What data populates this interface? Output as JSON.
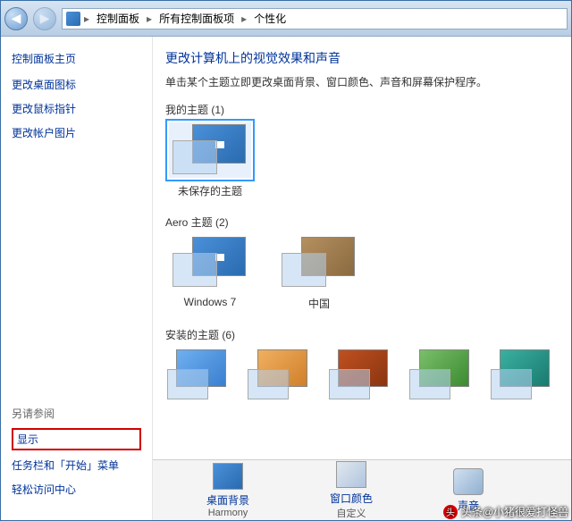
{
  "breadcrumb": {
    "items": [
      "控制面板",
      "所有控制面板项",
      "个性化"
    ]
  },
  "sidebar": {
    "heading": "控制面板主页",
    "links": [
      "更改桌面图标",
      "更改鼠标指针",
      "更改帐户图片"
    ],
    "see_also_heading": "另请参阅",
    "see_also": [
      "显示",
      "任务栏和「开始」菜单",
      "轻松访问中心"
    ]
  },
  "main": {
    "title": "更改计算机上的视觉效果和声音",
    "desc": "单击某个主题立即更改桌面背景、窗口颜色、声音和屏幕保护程序。",
    "sections": {
      "my_themes": {
        "label": "我的主题 (1)",
        "items": [
          {
            "label": "未保存的主题"
          }
        ]
      },
      "aero_themes": {
        "label": "Aero 主题 (2)",
        "items": [
          {
            "label": "Windows 7"
          },
          {
            "label": "中国"
          }
        ]
      },
      "installed_themes": {
        "label": "安装的主题 (6)"
      }
    }
  },
  "bottom": {
    "items": [
      {
        "label": "桌面背景",
        "sub": "Harmony"
      },
      {
        "label": "窗口颜色",
        "sub": "自定义"
      },
      {
        "label": "声音",
        "sub": ""
      }
    ]
  },
  "watermark": "头条@小猪很爱打怪兽"
}
